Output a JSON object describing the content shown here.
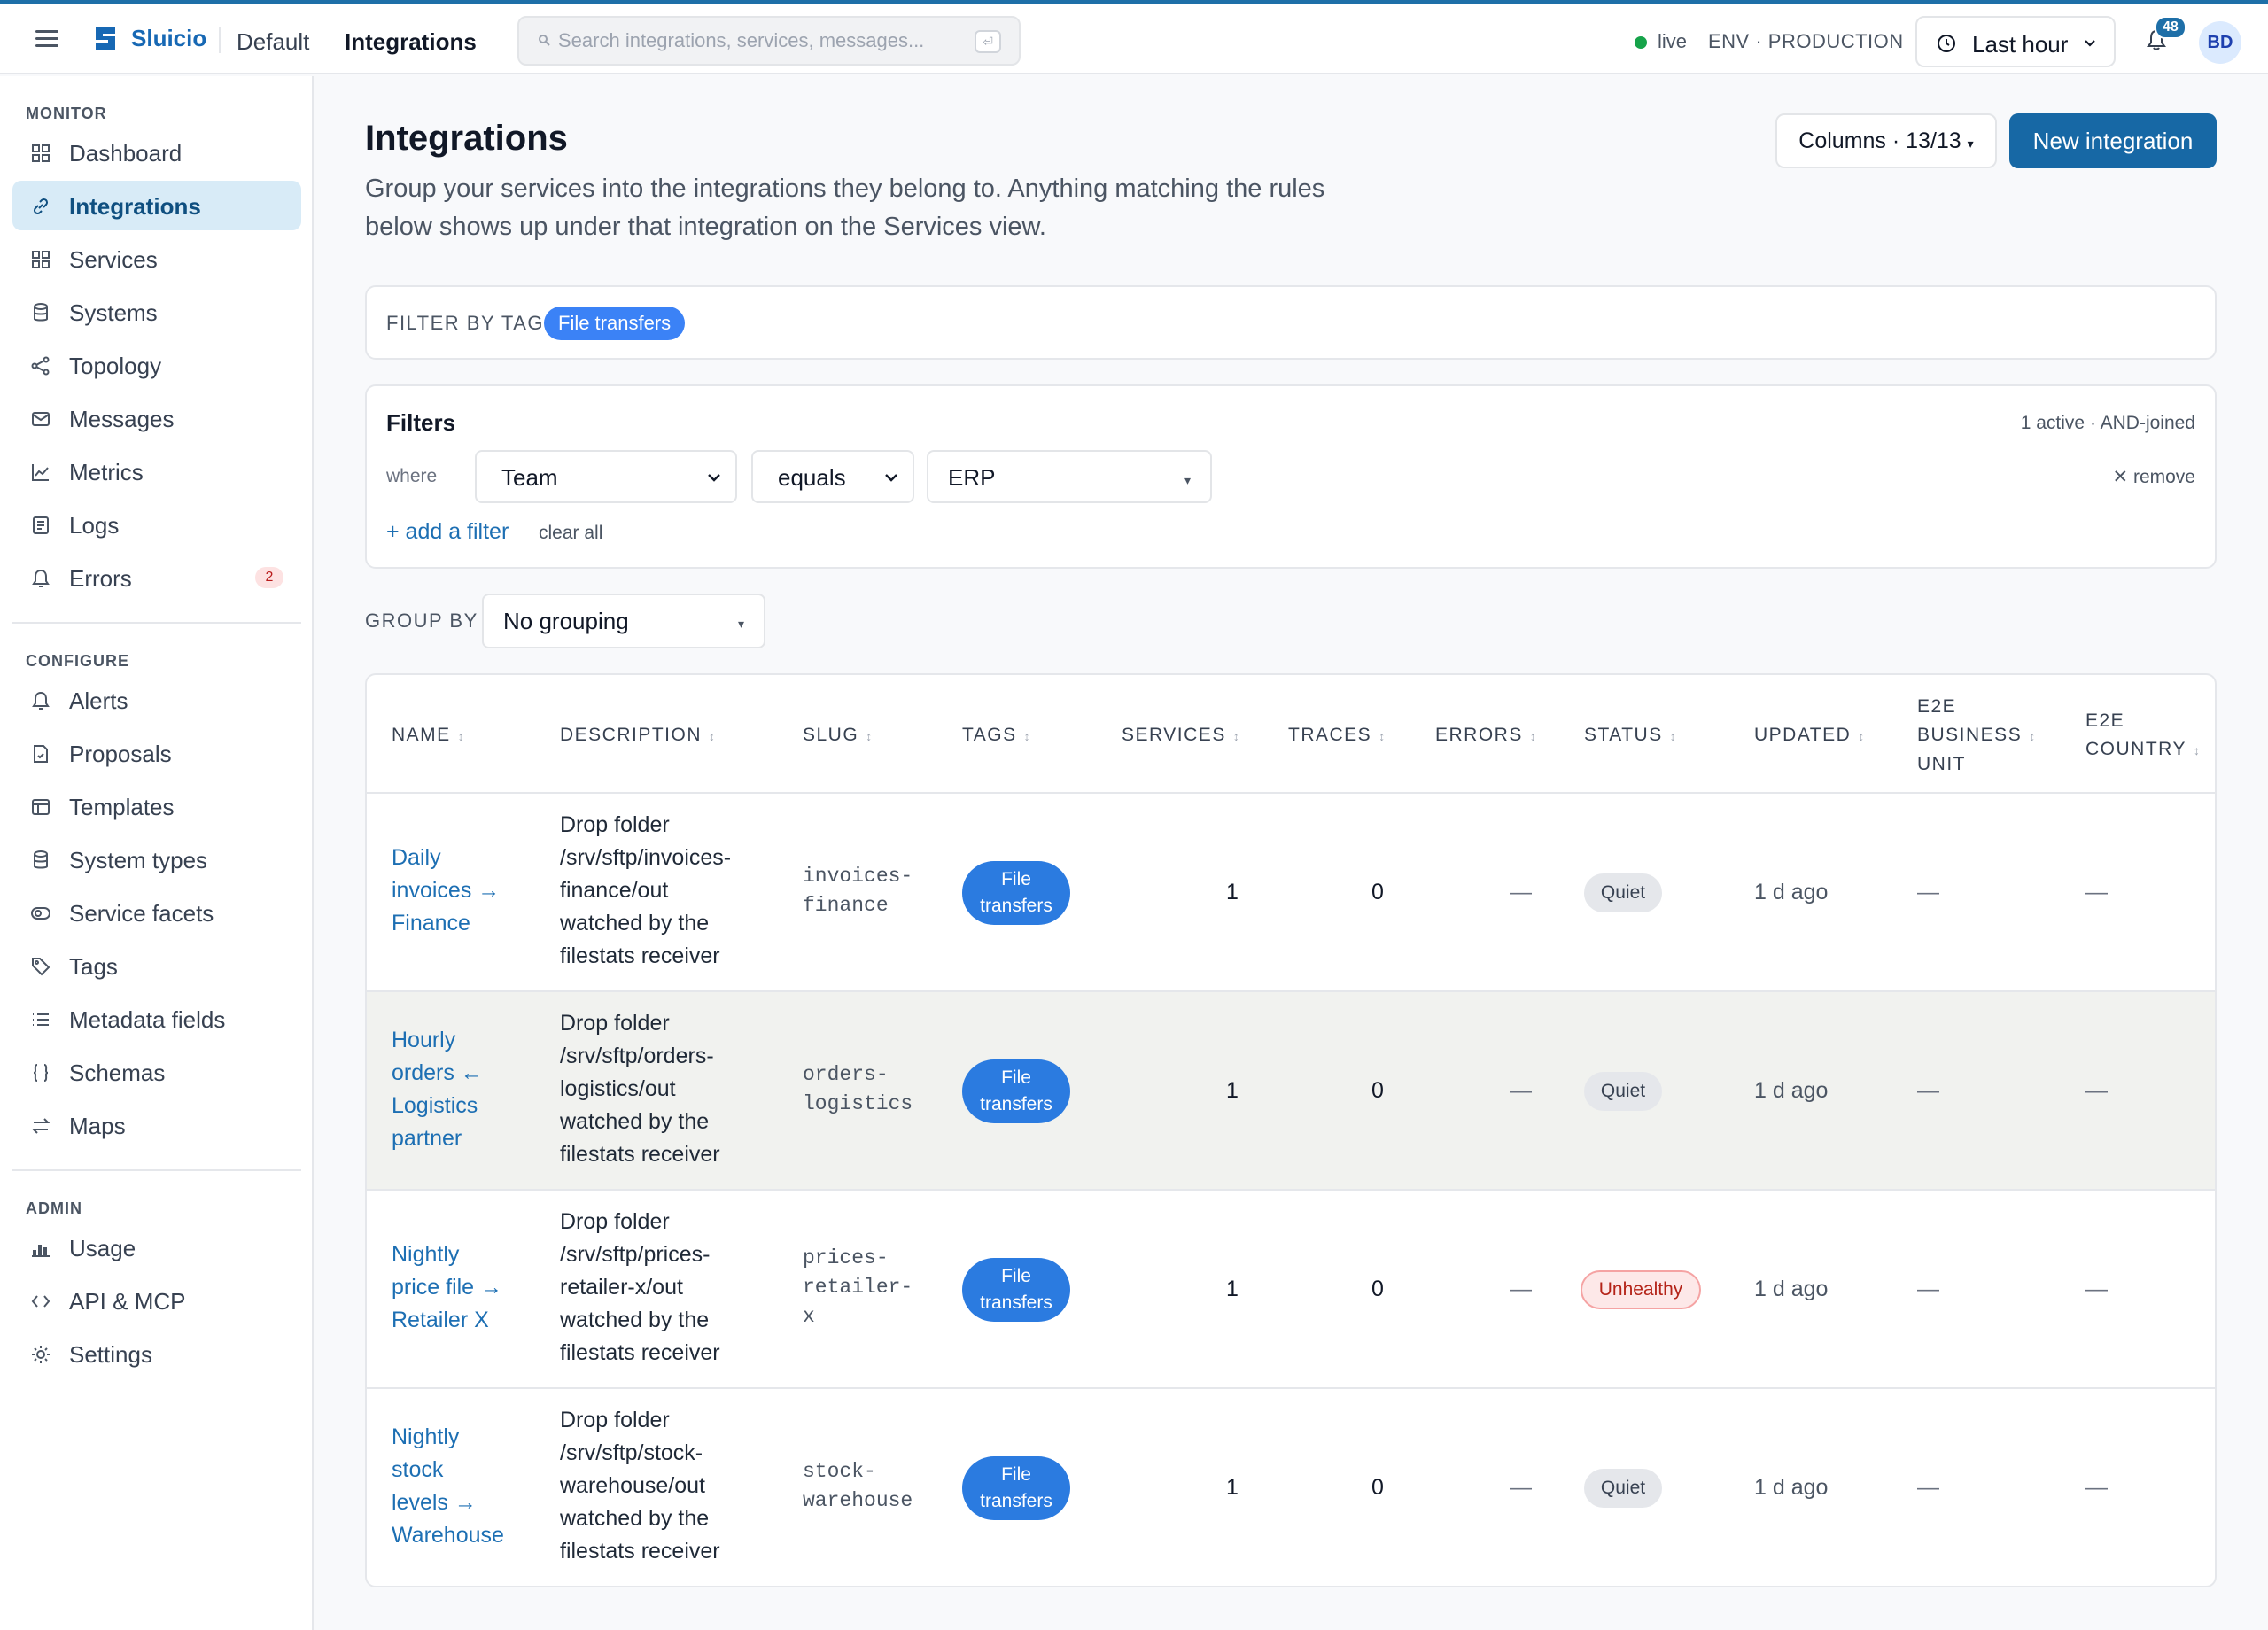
{
  "topbar": {
    "brand": "Sluicio",
    "breadcrumb_default": "Default",
    "breadcrumb_current": "Integrations",
    "search_placeholder": "Search integrations, services, messages...",
    "search_kbd": "⏎",
    "live_label": "live",
    "env_label": "ENV · PRODUCTION",
    "time_range": "Last hour",
    "notifications_count": "48",
    "avatar_initials": "BD"
  },
  "sidebar": {
    "monitor_title": "MONITOR",
    "configure_title": "CONFIGURE",
    "admin_title": "ADMIN",
    "monitor": [
      {
        "label": "Dashboard",
        "icon": "dashboard-icon"
      },
      {
        "label": "Integrations",
        "icon": "link-icon",
        "active": true
      },
      {
        "label": "Services",
        "icon": "grid-icon"
      },
      {
        "label": "Systems",
        "icon": "database-icon"
      },
      {
        "label": "Topology",
        "icon": "share-icon"
      },
      {
        "label": "Messages",
        "icon": "mail-icon"
      },
      {
        "label": "Metrics",
        "icon": "chart-icon"
      },
      {
        "label": "Logs",
        "icon": "document-icon"
      },
      {
        "label": "Errors",
        "icon": "bell-icon",
        "badge": "2"
      }
    ],
    "configure": [
      {
        "label": "Alerts",
        "icon": "bell-icon"
      },
      {
        "label": "Proposals",
        "icon": "proposal-icon"
      },
      {
        "label": "Templates",
        "icon": "template-icon"
      },
      {
        "label": "System types",
        "icon": "database-icon"
      },
      {
        "label": "Service facets",
        "icon": "facets-icon"
      },
      {
        "label": "Tags",
        "icon": "tag-icon"
      },
      {
        "label": "Metadata fields",
        "icon": "list-icon"
      },
      {
        "label": "Schemas",
        "icon": "braces-icon"
      },
      {
        "label": "Maps",
        "icon": "arrows-icon"
      }
    ],
    "admin": [
      {
        "label": "Usage",
        "icon": "bar-chart-icon"
      },
      {
        "label": "API & MCP",
        "icon": "code-icon"
      },
      {
        "label": "Settings",
        "icon": "sun-gear-icon"
      }
    ]
  },
  "main": {
    "title": "Integrations",
    "description": "Group your services into the integrations they belong to. Anything matching the rules below shows up under that integration on the Services view.",
    "columns_button": "Columns · 13/13",
    "columns_caret": "▾",
    "new_button": "New integration",
    "filter_by_tag_label": "FILTER BY TAG",
    "active_tag": "File transfers",
    "filters": {
      "heading": "Filters",
      "meta": "1 active · AND-joined",
      "where": "where",
      "field": "Team",
      "operator": "equals",
      "value": "ERP",
      "remove": "✕ remove",
      "add": "+ add a filter",
      "clear": "clear all"
    },
    "group_by_label": "GROUP BY",
    "group_by_value": "No grouping"
  },
  "table": {
    "sort_glyph": "↕",
    "headers": {
      "name": "NAME",
      "description": "DESCRIPTION",
      "slug": "SLUG",
      "tags": "TAGS",
      "services": "SERVICES",
      "traces": "TRACES",
      "errors": "ERRORS",
      "status": "STATUS",
      "updated": "UPDATED",
      "bu_line1": "E2E",
      "bu_line2": "BUSINESS",
      "bu_line3": "UNIT",
      "country_line1": "E2E",
      "country_line2": "COUNTRY"
    },
    "rows": [
      {
        "name": [
          "Daily",
          "invoices →",
          "Finance"
        ],
        "description": [
          "Drop folder",
          "/srv/sftp/invoices-",
          "finance/out",
          "watched by the",
          "filestats receiver"
        ],
        "slug": [
          "invoices-",
          "finance"
        ],
        "tag": [
          "File",
          "transfers"
        ],
        "services": "1",
        "traces": "0",
        "errors": "—",
        "status": "Quiet",
        "updated": "1 d ago",
        "bu": "—",
        "country": "—"
      },
      {
        "name": [
          "Hourly",
          "orders ←",
          "Logistics",
          "partner"
        ],
        "description": [
          "Drop folder",
          "/srv/sftp/orders-",
          "logistics/out",
          "watched by the",
          "filestats receiver"
        ],
        "slug": [
          "orders-",
          "logistics"
        ],
        "tag": [
          "File",
          "transfers"
        ],
        "services": "1",
        "traces": "0",
        "errors": "—",
        "status": "Quiet",
        "updated": "1 d ago",
        "bu": "—",
        "country": "—"
      },
      {
        "name": [
          "Nightly",
          "price file →",
          "Retailer X"
        ],
        "description": [
          "Drop folder",
          "/srv/sftp/prices-",
          "retailer-x/out",
          "watched by the",
          "filestats receiver"
        ],
        "slug": [
          "prices-",
          "retailer-",
          "x"
        ],
        "tag": [
          "File",
          "transfers"
        ],
        "services": "1",
        "traces": "0",
        "errors": "—",
        "status": "Unhealthy",
        "updated": "1 d ago",
        "bu": "—",
        "country": "—"
      },
      {
        "name": [
          "Nightly",
          "stock",
          "levels →",
          "Warehouse"
        ],
        "description": [
          "Drop folder",
          "/srv/sftp/stock-",
          "warehouse/out",
          "watched by the",
          "filestats receiver"
        ],
        "slug": [
          "stock-",
          "warehouse"
        ],
        "tag": [
          "File",
          "transfers"
        ],
        "services": "1",
        "traces": "0",
        "errors": "—",
        "status": "Quiet",
        "updated": "1 d ago",
        "bu": "—",
        "country": "—"
      }
    ]
  },
  "colors": {
    "brand": "#1768b4",
    "primary_button": "#1768a5",
    "tag_chip": "#2b7be0",
    "link": "#1d6fb3",
    "active_nav_bg": "#d8ebf7",
    "live_dot": "#16a34a",
    "unhealthy_text": "#b42318"
  }
}
